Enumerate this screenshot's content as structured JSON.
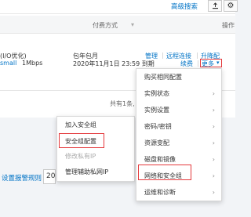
{
  "toolbar": {
    "advanced_search": "高级搜索"
  },
  "table": {
    "headers": {
      "pay_method": "付费方式",
      "operations": "操作"
    },
    "row": {
      "spec_line1": "(I/O优化)",
      "spec_small": "small",
      "bandwidth": "1Mbps",
      "billing_type": "包年包月",
      "expire": "2020年11月1日 23:59 到期",
      "actions": {
        "manage": "管理",
        "remote": "远程连接",
        "upgrade": "升降配",
        "renew": "续费",
        "more": "更多"
      }
    }
  },
  "pagination": {
    "summary": "共有1条, 每页显示:",
    "page_size": "20",
    "suffix": "条"
  },
  "left_panel": {
    "link": "设置报警规则",
    "value": "20"
  },
  "more_menu": {
    "items": [
      {
        "label": "购买相同配置",
        "submenu": false
      },
      {
        "label": "实例状态",
        "submenu": true
      },
      {
        "label": "实例设置",
        "submenu": true
      },
      {
        "label": "密码/密钥",
        "submenu": true
      },
      {
        "label": "资源变配",
        "submenu": true
      },
      {
        "label": "磁盘和镜像",
        "submenu": true
      },
      {
        "label": "网络和安全组",
        "submenu": true
      },
      {
        "label": "运维和诊断",
        "submenu": true
      }
    ]
  },
  "sub_menu": {
    "items": [
      {
        "label": "加入安全组",
        "disabled": false
      },
      {
        "label": "安全组配置",
        "disabled": false
      },
      {
        "label": "修改私有IP",
        "disabled": true
      },
      {
        "label": "管理辅助私网IP",
        "disabled": false
      }
    ]
  },
  "colors": {
    "link": "#0073c6",
    "highlight": "#e4393c"
  }
}
